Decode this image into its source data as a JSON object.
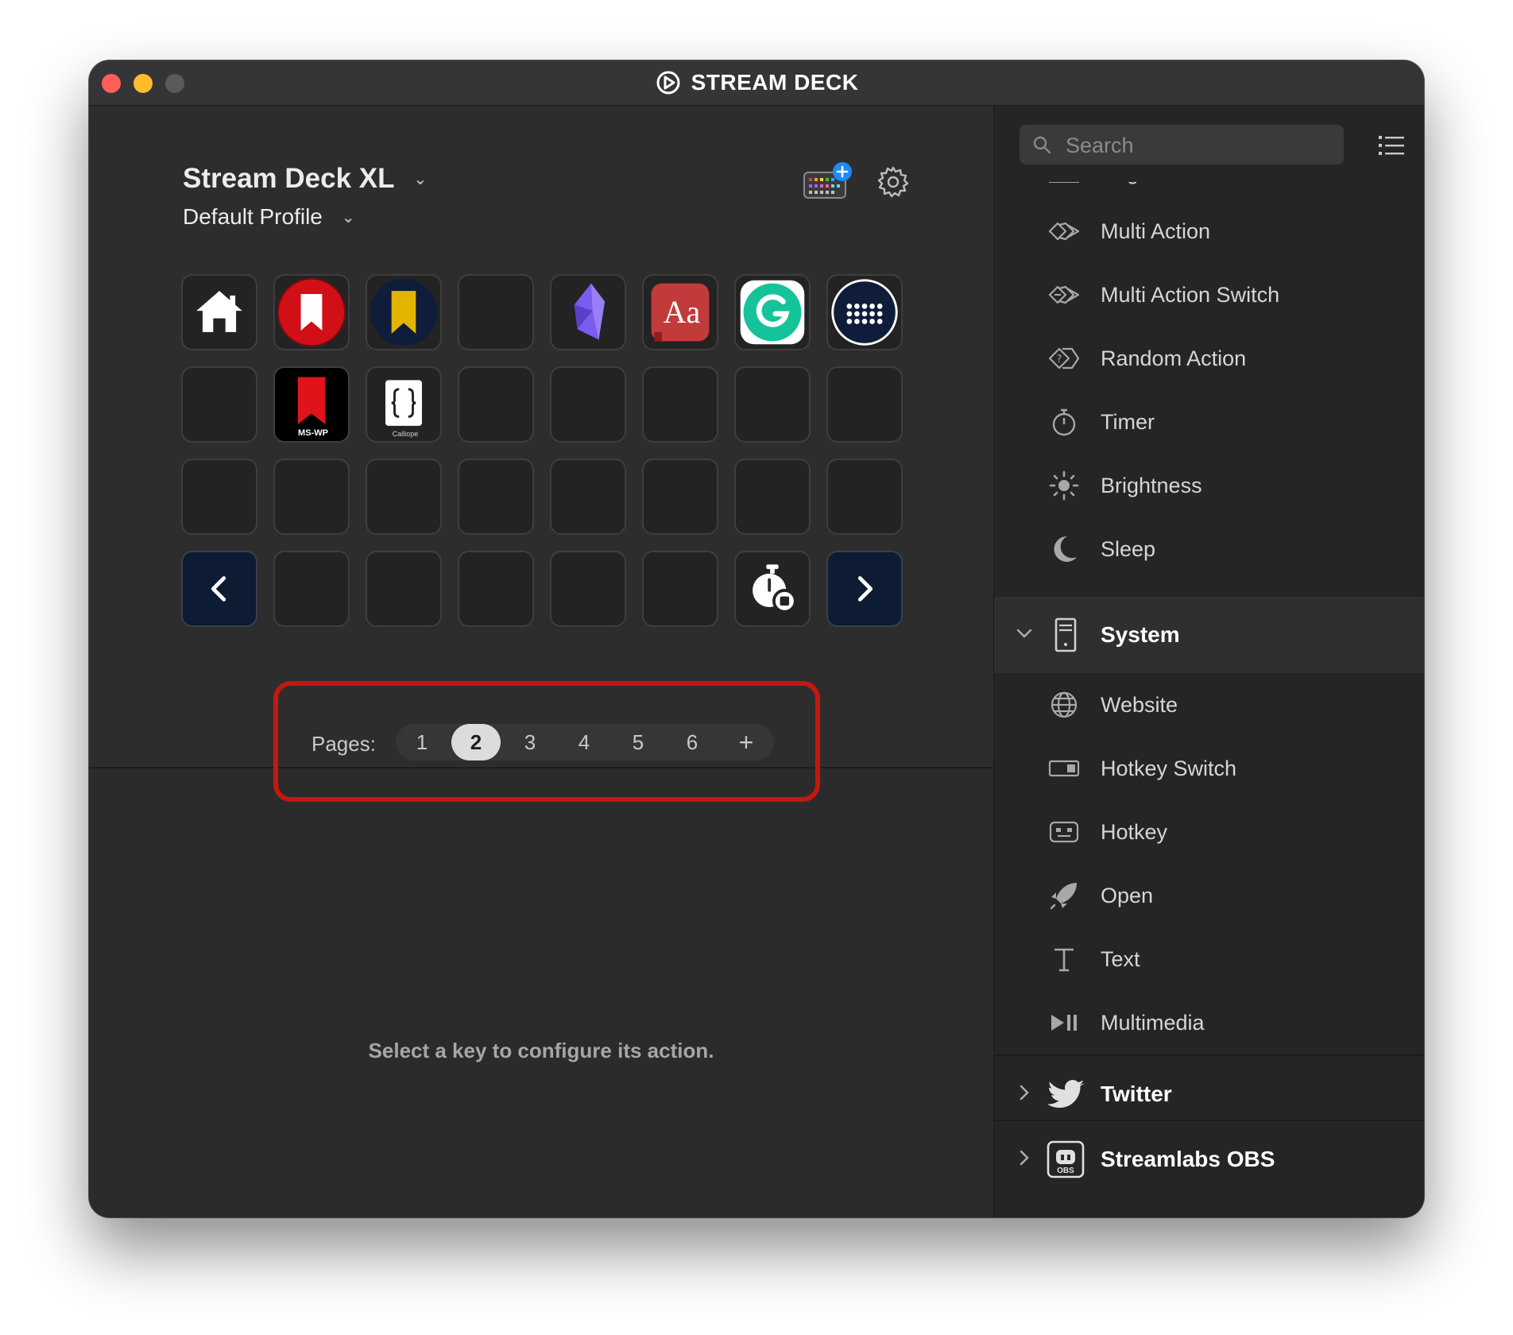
{
  "window": {
    "title": "STREAM DECK"
  },
  "header": {
    "device": "Stream Deck XL",
    "profile": "Default Profile",
    "chevron": "⌄"
  },
  "keys": {
    "ms_wp_label": "MS-WP",
    "calliope_label": "Calliope",
    "dictionary_label": "Aa"
  },
  "pages": {
    "label": "Pages:",
    "items": [
      "1",
      "2",
      "3",
      "4",
      "5",
      "6"
    ],
    "active": "2",
    "add": "+"
  },
  "hint": "Select a key to configure its action.",
  "search": {
    "placeholder": "Search"
  },
  "actions": {
    "partial": "Page Indicator",
    "navigation_items": [
      {
        "label": "Multi Action",
        "icon": "multi-action-icon"
      },
      {
        "label": "Multi Action Switch",
        "icon": "multi-action-switch-icon"
      },
      {
        "label": "Random Action",
        "icon": "random-action-icon"
      },
      {
        "label": "Timer",
        "icon": "timer-icon"
      },
      {
        "label": "Brightness",
        "icon": "brightness-icon"
      },
      {
        "label": "Sleep",
        "icon": "moon-icon"
      }
    ],
    "system": {
      "title": "System",
      "items": [
        {
          "label": "Website",
          "icon": "globe-icon"
        },
        {
          "label": "Hotkey Switch",
          "icon": "hotkey-switch-icon"
        },
        {
          "label": "Hotkey",
          "icon": "hotkey-icon"
        },
        {
          "label": "Open",
          "icon": "rocket-icon"
        },
        {
          "label": "Text",
          "icon": "text-icon"
        },
        {
          "label": "Multimedia",
          "icon": "play-pause-icon"
        }
      ]
    },
    "twitter": {
      "title": "Twitter"
    },
    "streamlabs": {
      "title": "Streamlabs OBS",
      "badge": "OBS"
    }
  },
  "colors": {
    "highlight": "#c2190f",
    "accent_blue": "#1e88ff",
    "grammarly": "#15c39a",
    "obsidian": "#7b5cf0"
  }
}
